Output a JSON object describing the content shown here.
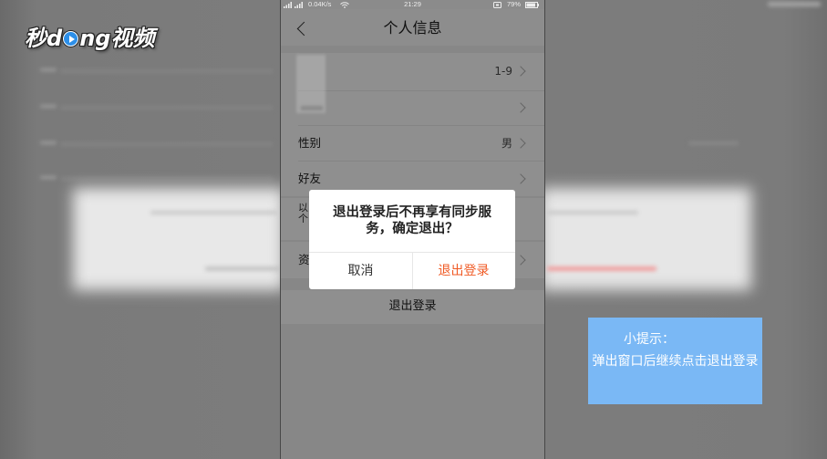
{
  "logo": {
    "prefix": "秒d",
    "suffix": "ng视频",
    "icon": "play-circle-icon",
    "icon_color": "#2d8fe8"
  },
  "status_bar": {
    "network_speed": "0.04K/s",
    "time": "21:29",
    "battery": "79%",
    "icons": [
      "signal-icon",
      "wifi-icon",
      "status-indicator-icon",
      "battery-icon"
    ]
  },
  "header": {
    "title": "个人信息",
    "back_icon": "chevron-left-icon"
  },
  "profile": {
    "avatar_row_value": "1-9",
    "gender_label": "性别",
    "gender_value": "男",
    "friends_label": "好友",
    "notice_lines": [
      "以",
      "个"
    ],
    "data_row_label": "资",
    "logout_label": "退出登录",
    "row_icon": "chevron-right-icon"
  },
  "dialog": {
    "message": "退出登录后不再享有同步服务，确定退出？",
    "cancel_label": "取消",
    "confirm_label": "退出登录",
    "confirm_color": "#f05a24"
  },
  "tip": {
    "title": "小提示：",
    "body": "弹出窗口后继续点击退出登录",
    "background": "#7ab8f5"
  }
}
